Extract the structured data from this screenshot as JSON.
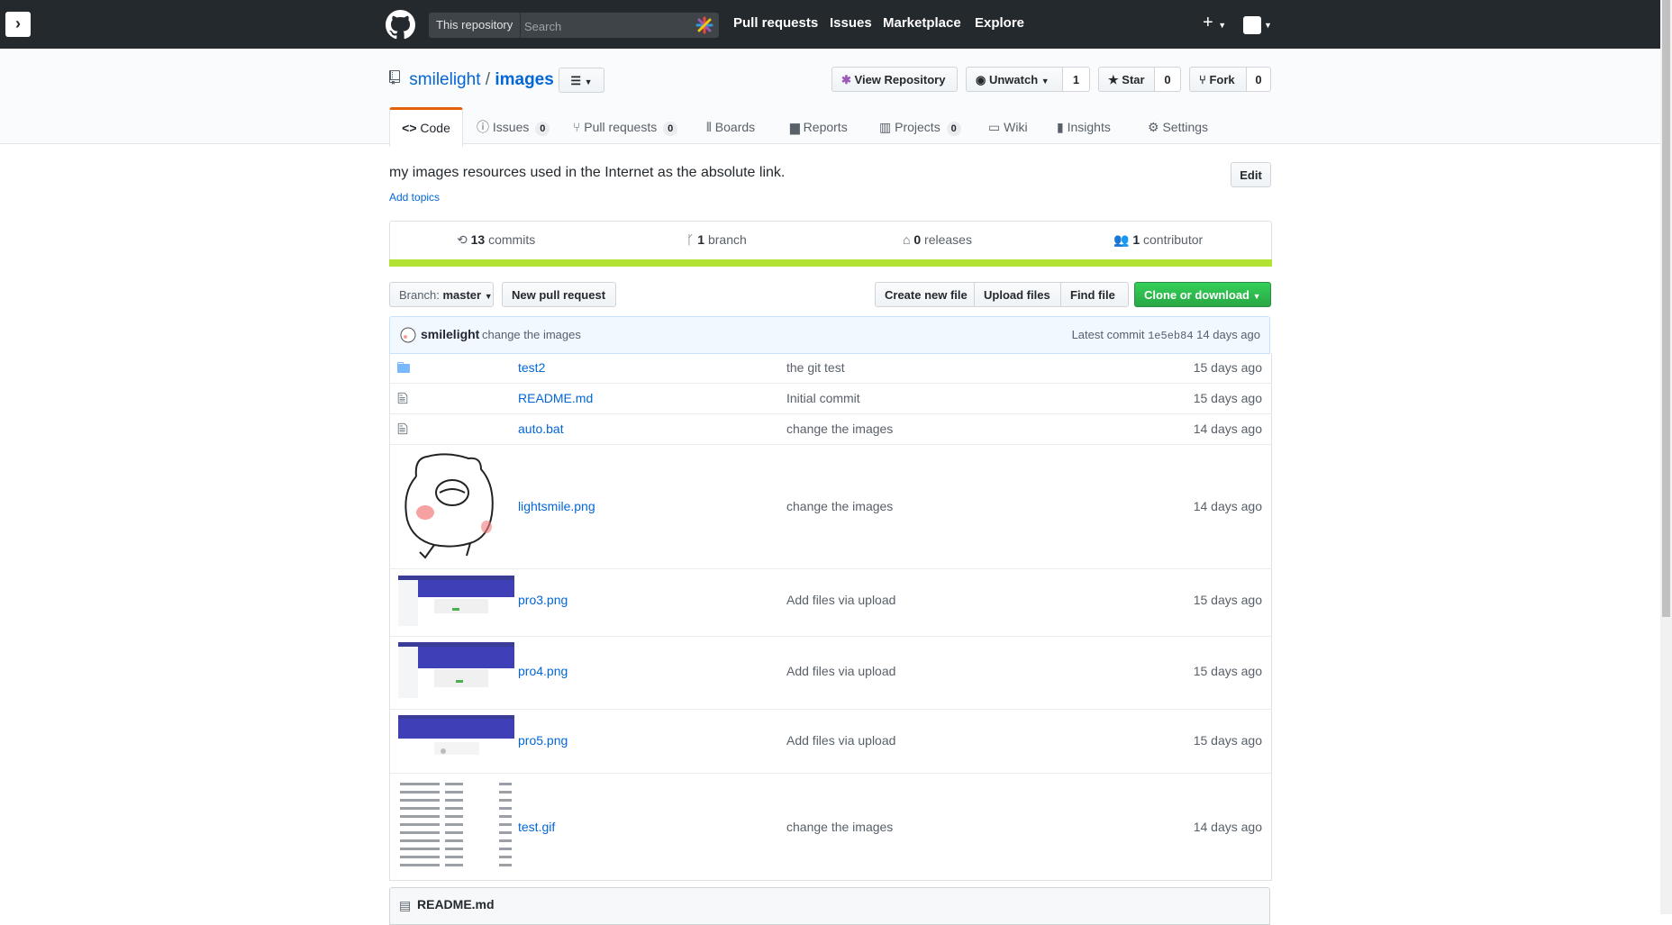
{
  "header": {
    "search_scope": "This repository",
    "search_placeholder": "Search",
    "nav": [
      "Pull requests",
      "Issues",
      "Marketplace",
      "Explore"
    ],
    "plus": "+"
  },
  "repo": {
    "owner": "smilelight",
    "separator": "/",
    "name": "images",
    "view_repository": "View Repository",
    "watch_label": "Unwatch",
    "watch_count": "1",
    "star_label": "Star",
    "star_count": "0",
    "fork_label": "Fork",
    "fork_count": "0"
  },
  "tabs": [
    {
      "label": "Code"
    },
    {
      "label": "Issues",
      "count": "0"
    },
    {
      "label": "Pull requests",
      "count": "0"
    },
    {
      "label": "Boards"
    },
    {
      "label": "Reports"
    },
    {
      "label": "Projects",
      "count": "0"
    },
    {
      "label": "Wiki"
    },
    {
      "label": "Insights"
    },
    {
      "label": "Settings"
    }
  ],
  "description": "my images resources used in the Internet as the absolute link.",
  "edit_label": "Edit",
  "add_topics": "Add topics",
  "summary": {
    "commits_num": "13",
    "commits_label": "commits",
    "branch_num": "1",
    "branch_label": "branch",
    "releases_num": "0",
    "releases_label": "releases",
    "contributors_num": "1",
    "contributors_label": "contributor"
  },
  "toolbar": {
    "branch_prefix": "Branch:",
    "branch_name": "master",
    "new_pull_request": "New pull request",
    "create_new_file": "Create new file",
    "upload_files": "Upload files",
    "find_file": "Find file",
    "clone_or_download": "Clone or download"
  },
  "latest_commit": {
    "author": "smilelight",
    "message": "change the images",
    "prefix": "Latest commit",
    "sha": "1e5eb84",
    "age": "14 days ago"
  },
  "files": [
    {
      "name": "test2",
      "message": "the git test",
      "age": "15 days ago",
      "type": "folder"
    },
    {
      "name": "README.md",
      "message": "Initial commit",
      "age": "15 days ago",
      "type": "file"
    },
    {
      "name": "auto.bat",
      "message": "change the images",
      "age": "14 days ago",
      "type": "file"
    },
    {
      "name": "lightsmile.png",
      "message": "change the images",
      "age": "14 days ago",
      "type": "image"
    },
    {
      "name": "pro3.png",
      "message": "Add files via upload",
      "age": "15 days ago",
      "type": "image"
    },
    {
      "name": "pro4.png",
      "message": "Add files via upload",
      "age": "15 days ago",
      "type": "image"
    },
    {
      "name": "pro5.png",
      "message": "Add files via upload",
      "age": "15 days ago",
      "type": "image"
    },
    {
      "name": "test.gif",
      "message": "change the images",
      "age": "14 days ago",
      "type": "image"
    }
  ],
  "readme_title": "README.md",
  "colors": {
    "header_bg": "#24292e",
    "link": "#0366d6",
    "green_button": "#28a745",
    "language_bar": "#b2e234",
    "selected_tab_accent": "#e36209"
  }
}
